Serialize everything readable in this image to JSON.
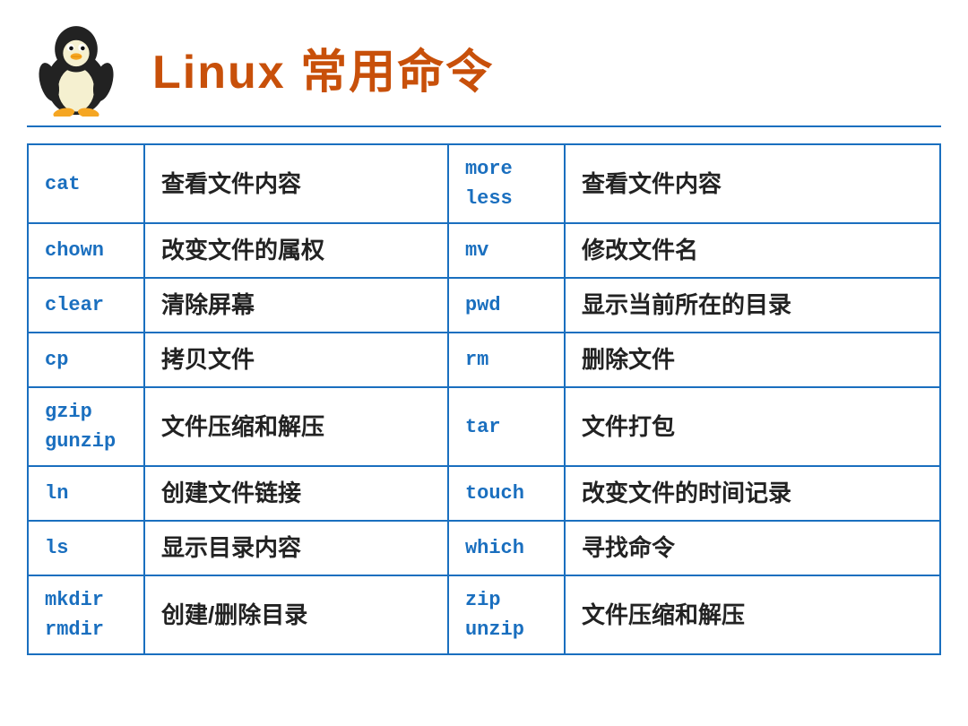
{
  "header": {
    "title": "Linux 常用命令"
  },
  "table": {
    "rows": [
      {
        "left_cmd": "cat",
        "left_desc": "查看文件内容",
        "right_cmd": "more\nless",
        "right_desc": "查看文件内容"
      },
      {
        "left_cmd": "chown",
        "left_desc": "改变文件的属权",
        "right_cmd": "mv",
        "right_desc": "修改文件名"
      },
      {
        "left_cmd": "clear",
        "left_desc": "清除屏幕",
        "right_cmd": "pwd",
        "right_desc": "显示当前所在的目录"
      },
      {
        "left_cmd": "cp",
        "left_desc": "拷贝文件",
        "right_cmd": "rm",
        "right_desc": "删除文件"
      },
      {
        "left_cmd": "gzip\ngunzip",
        "left_desc": "文件压缩和解压",
        "right_cmd": "tar",
        "right_desc": "文件打包"
      },
      {
        "left_cmd": "ln",
        "left_desc": "创建文件链接",
        "right_cmd": "touch",
        "right_desc": "改变文件的时间记录"
      },
      {
        "left_cmd": "ls",
        "left_desc": "显示目录内容",
        "right_cmd": "which",
        "right_desc": "寻找命令"
      },
      {
        "left_cmd": "mkdir\nrmdir",
        "left_desc": "创建/删除目录",
        "right_cmd": "zip\nunzip",
        "right_desc": "文件压缩和解压"
      }
    ]
  }
}
